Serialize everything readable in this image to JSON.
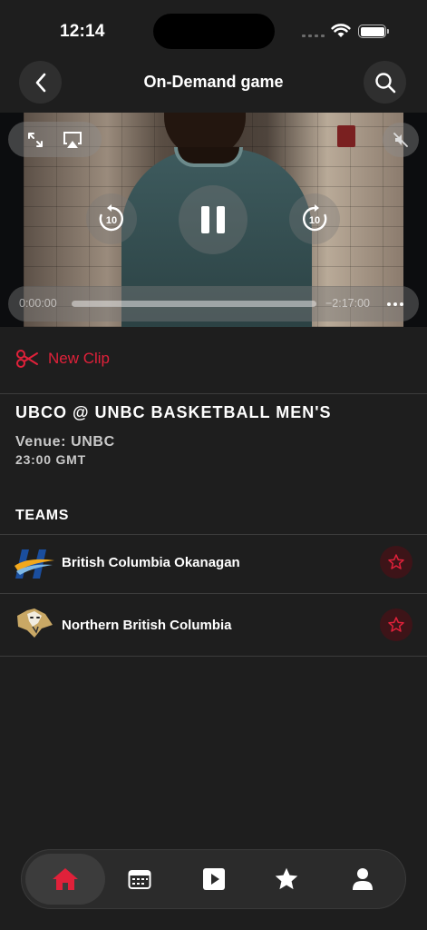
{
  "status_bar": {
    "time": "12:14"
  },
  "nav": {
    "title": "On-Demand game"
  },
  "player": {
    "time_elapsed": "0:00:00",
    "time_remaining": "−2:17:00",
    "skip_back_seconds": "10",
    "skip_forward_seconds": "10",
    "progress": 0.0
  },
  "clip": {
    "label": "New Clip"
  },
  "game": {
    "title": "UBCO @ UNBC BASKETBALL MEN'S",
    "venue": "Venue: UNBC",
    "time": "23:00 GMT"
  },
  "teams": {
    "heading": "TEAMS",
    "items": [
      {
        "name": "British Columbia Okanagan"
      },
      {
        "name": "Northern British Columbia"
      }
    ]
  },
  "colors": {
    "accent": "#e0213a",
    "background": "#1e1e1e",
    "star_bg": "#3d1418"
  },
  "tabs": [
    {
      "icon": "home-icon",
      "active": true
    },
    {
      "icon": "calendar-icon",
      "active": false
    },
    {
      "icon": "play-icon",
      "active": false
    },
    {
      "icon": "star-icon",
      "active": false
    },
    {
      "icon": "person-icon",
      "active": false
    }
  ]
}
